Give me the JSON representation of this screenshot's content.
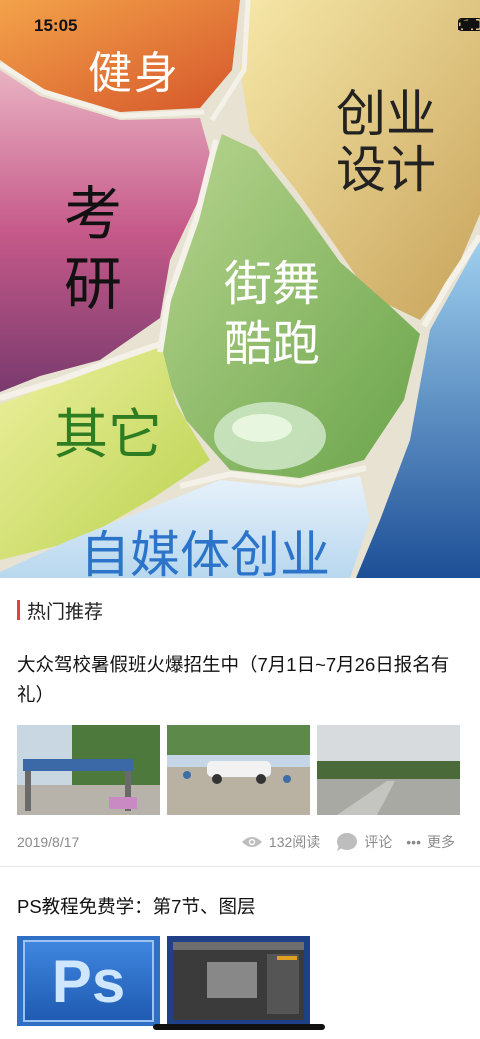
{
  "status_bar": {
    "time": "15:05"
  },
  "banner": {
    "labels": {
      "fitness": "健身",
      "startup_design": "创业设计",
      "postgrad_exam": "考研",
      "dance_parkour": "街舞酷跑",
      "other": "其它",
      "self_media": "自媒体创业"
    }
  },
  "section": {
    "title": "热门推荐"
  },
  "articles": [
    {
      "title": "大众驾校暑假班火爆招生中（7月1日~7月26日报名有礼）",
      "date": "2019/8/17",
      "views": "132阅读",
      "comment_label": "评论",
      "more_label": "更多"
    },
    {
      "title": "PS教程免费学：第7节、图层",
      "thumb_ps_text": "Ps"
    }
  ],
  "colors": {
    "accent": "#e3413a",
    "other_label": "#2f7d22",
    "media_label": "#2b74c9"
  }
}
